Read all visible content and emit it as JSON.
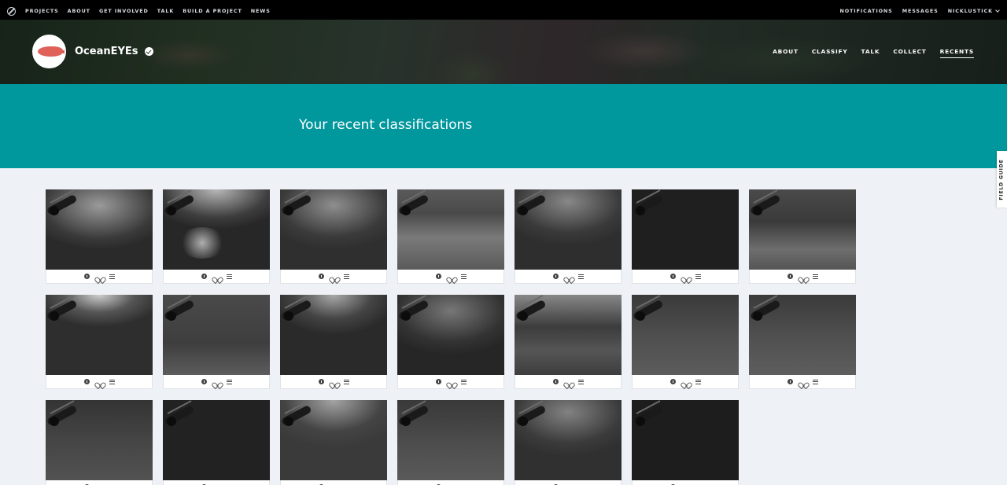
{
  "topnav": {
    "items": [
      "PROJECTS",
      "ABOUT",
      "GET INVOLVED",
      "TALK",
      "BUILD A PROJECT",
      "NEWS"
    ],
    "right": {
      "notifications": "NOTIFICATIONS",
      "messages": "MESSAGES",
      "user": "NICKLUSTICK"
    }
  },
  "project": {
    "title": "OceanEYEs",
    "nav": [
      "ABOUT",
      "CLASSIFY",
      "TALK",
      "COLLECT",
      "RECENTS"
    ],
    "active_nav": "RECENTS"
  },
  "banner": {
    "title": "Your recent classifications"
  },
  "field_guide": {
    "label": "FIELD GUIDE"
  },
  "recents": {
    "count": 20,
    "icons": [
      "info-icon",
      "heart-icon",
      "list-icon"
    ]
  }
}
